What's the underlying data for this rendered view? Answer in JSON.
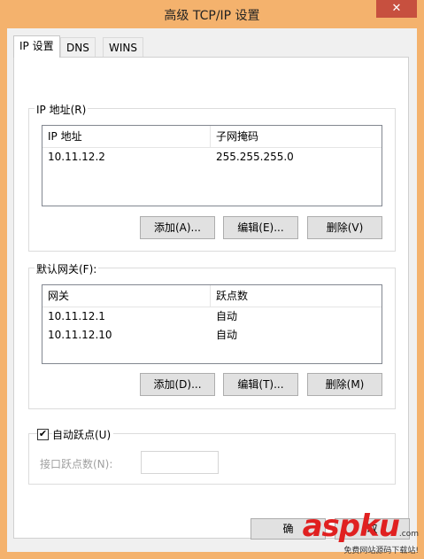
{
  "window": {
    "title": "高级 TCP/IP 设置",
    "close_glyph": "✕"
  },
  "tabs": [
    {
      "label": "IP 设置"
    },
    {
      "label": "DNS"
    },
    {
      "label": "WINS"
    }
  ],
  "ip_group": {
    "title": "IP 地址(R)",
    "col1": "IP 地址",
    "col2": "子网掩码",
    "rows": [
      {
        "ip": "10.11.12.2",
        "mask": "255.255.255.0"
      }
    ],
    "add": "添加(A)...",
    "edit": "编辑(E)...",
    "delete": "删除(V)"
  },
  "gw_group": {
    "title": "默认网关(F):",
    "col1": "网关",
    "col2": "跃点数",
    "rows": [
      {
        "gateway": "10.11.12.1",
        "metric": "自动"
      },
      {
        "gateway": "10.11.12.10",
        "metric": "自动"
      }
    ],
    "add": "添加(D)...",
    "edit": "编辑(T)...",
    "delete": "删除(M)"
  },
  "auto_metric": {
    "label": "自动跃点(U)",
    "checked": true,
    "check_glyph": "✔",
    "interface_metric_label": "接口跃点数(N):",
    "interface_metric_value": ""
  },
  "bottom": {
    "ok_partial": "确",
    "cancel_partial": "取"
  },
  "watermark": {
    "brand": "aspku",
    "suffix": ".com",
    "tagline": "免费网站源码下载站!"
  }
}
